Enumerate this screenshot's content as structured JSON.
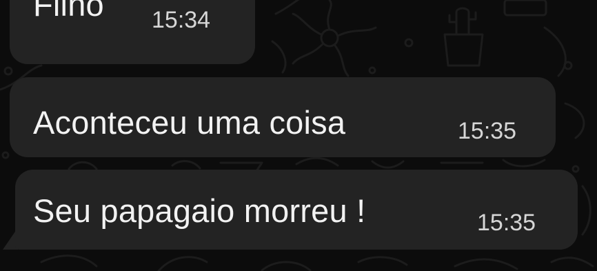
{
  "chat": {
    "messages": [
      {
        "text": "Filho",
        "time": "15:34"
      },
      {
        "text": "Aconteceu uma coisa",
        "time": "15:35"
      },
      {
        "text": "Seu papagaio morreu !",
        "time": "15:35"
      }
    ]
  },
  "colors": {
    "background": "#0c0c0c",
    "bubble": "#232323",
    "text": "#f2f2f2",
    "timestamp": "#d6d6d6"
  }
}
